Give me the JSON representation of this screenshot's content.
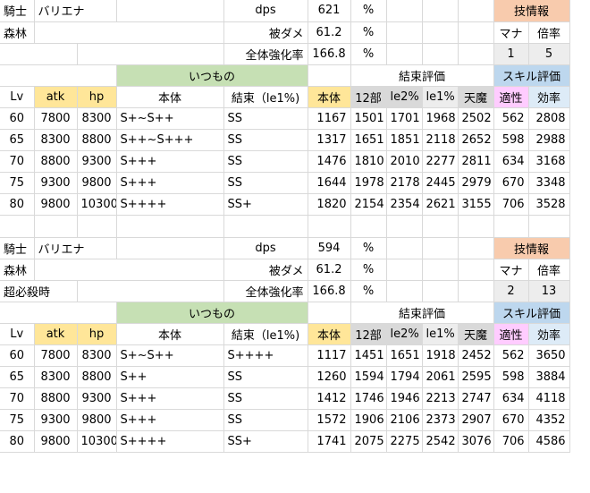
{
  "blocks": [
    {
      "class": "騎士",
      "name": "バリエナ",
      "area": "森林",
      "extra": "",
      "dps_label": "dps",
      "dps": "621",
      "hit_label": "被ダメ",
      "hit": "61.2",
      "boost_label": "全体強化率",
      "boost": "166.8",
      "pct": "%",
      "skillinfo_label": "技情報",
      "mana_label": "マナ",
      "mult_label": "倍率",
      "mana": "1",
      "mult": "5",
      "group_itsumono": "いつもの",
      "group_kessoku": "結束評価",
      "group_skill": "スキル評価",
      "headers": [
        "Lv",
        "atk",
        "hp",
        "本体",
        "結束（le1%)",
        "本体",
        "12部",
        "le2%",
        "le1%",
        "天魔",
        "適性",
        "効率"
      ],
      "rows": [
        [
          "60",
          "7800",
          "8300",
          "S+~S++",
          "SS",
          "1167",
          "1501",
          "1701",
          "1968",
          "2502",
          "562",
          "2808"
        ],
        [
          "65",
          "8300",
          "8800",
          "S++~S+++",
          "SS",
          "1317",
          "1651",
          "1851",
          "2118",
          "2652",
          "598",
          "2988"
        ],
        [
          "70",
          "8800",
          "9300",
          "S+++",
          "SS",
          "1476",
          "1810",
          "2010",
          "2277",
          "2811",
          "634",
          "3168"
        ],
        [
          "75",
          "9300",
          "9800",
          "S+++",
          "SS",
          "1644",
          "1978",
          "2178",
          "2445",
          "2979",
          "670",
          "3348"
        ],
        [
          "80",
          "9800",
          "10300",
          "S++++",
          "SS+",
          "1820",
          "2154",
          "2354",
          "2621",
          "3155",
          "706",
          "3528"
        ]
      ]
    },
    {
      "class": "騎士",
      "name": "バリエナ",
      "area": "森林",
      "extra": "超必殺時",
      "dps_label": "dps",
      "dps": "594",
      "hit_label": "被ダメ",
      "hit": "61.2",
      "boost_label": "全体強化率",
      "boost": "166.8",
      "pct": "%",
      "skillinfo_label": "技情報",
      "mana_label": "マナ",
      "mult_label": "倍率",
      "mana": "2",
      "mult": "13",
      "group_itsumono": "いつもの",
      "group_kessoku": "結束評価",
      "group_skill": "スキル評価",
      "headers": [
        "Lv",
        "atk",
        "hp",
        "本体",
        "結束（le1%)",
        "本体",
        "12部",
        "le2%",
        "le1%",
        "天魔",
        "適性",
        "効率"
      ],
      "rows": [
        [
          "60",
          "7800",
          "8300",
          "S+~S++",
          "S++++",
          "1117",
          "1451",
          "1651",
          "1918",
          "2452",
          "562",
          "3650"
        ],
        [
          "65",
          "8300",
          "8800",
          "S++",
          "SS",
          "1260",
          "1594",
          "1794",
          "2061",
          "2595",
          "598",
          "3884"
        ],
        [
          "70",
          "8800",
          "9300",
          "S+++",
          "SS",
          "1412",
          "1746",
          "1946",
          "2213",
          "2747",
          "634",
          "4118"
        ],
        [
          "75",
          "9300",
          "9800",
          "S+++",
          "SS",
          "1572",
          "1906",
          "2106",
          "2373",
          "2907",
          "670",
          "4352"
        ],
        [
          "80",
          "9800",
          "10300",
          "S++++",
          "SS+",
          "1741",
          "2075",
          "2275",
          "2542",
          "3076",
          "706",
          "4586"
        ]
      ]
    }
  ]
}
